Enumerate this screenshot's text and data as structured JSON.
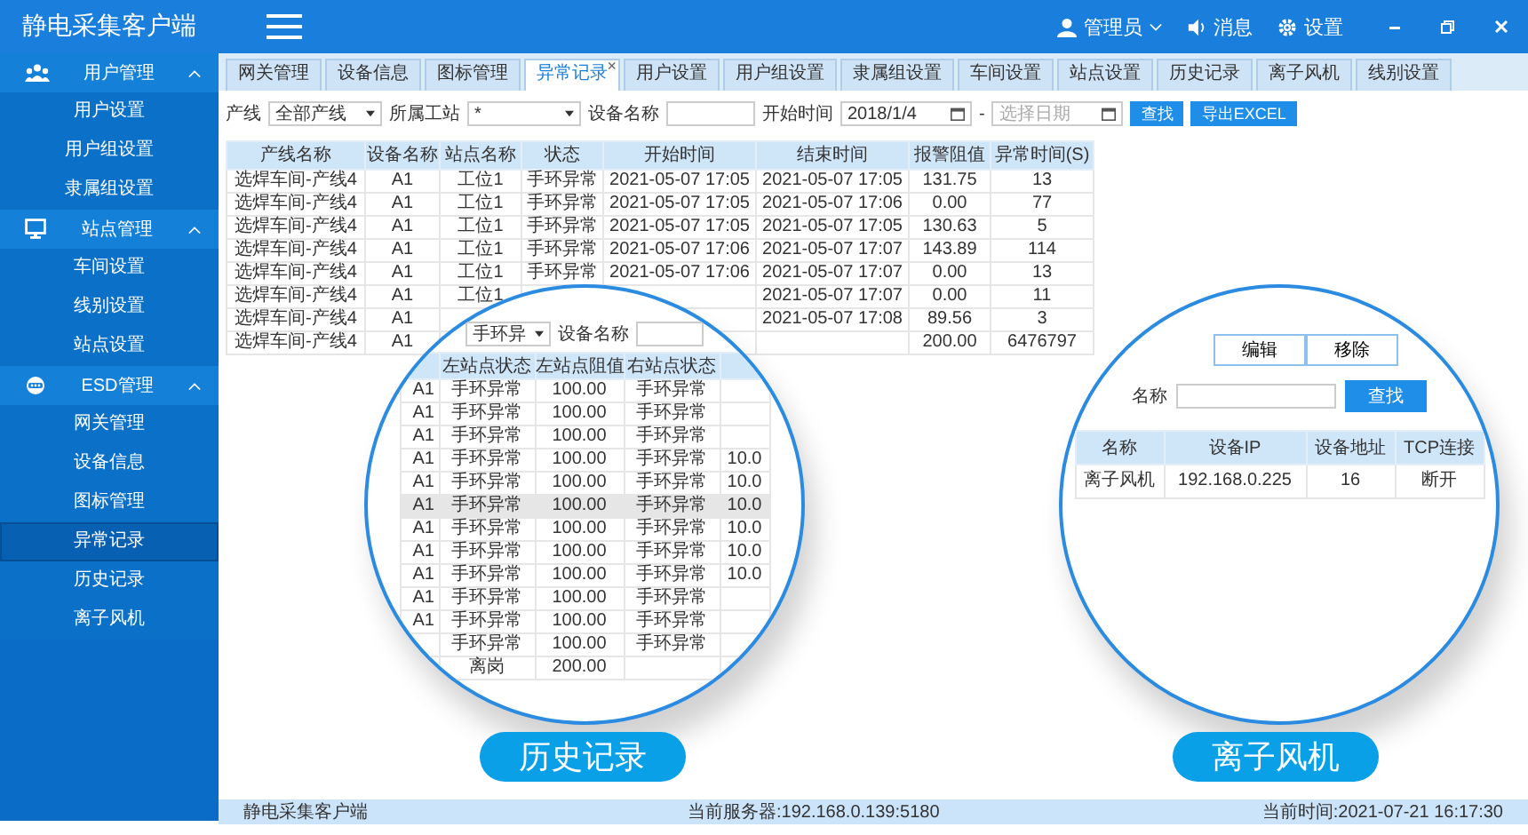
{
  "app": {
    "title": "静电采集客户端"
  },
  "topbar": {
    "user": "管理员",
    "messages": "消息",
    "settings": "设置"
  },
  "sidebar": [
    {
      "label": "用户管理",
      "expanded": true,
      "children": [
        {
          "label": "用户设置",
          "selected": false
        },
        {
          "label": "用户组设置",
          "selected": false
        },
        {
          "label": "隶属组设置",
          "selected": false
        }
      ]
    },
    {
      "label": "站点管理",
      "expanded": true,
      "children": [
        {
          "label": "车间设置",
          "selected": false
        },
        {
          "label": "线别设置",
          "selected": false
        },
        {
          "label": "站点设置",
          "selected": false
        }
      ]
    },
    {
      "label": "ESD管理",
      "expanded": true,
      "children": [
        {
          "label": "网关管理",
          "selected": false
        },
        {
          "label": "设备信息",
          "selected": false
        },
        {
          "label": "图标管理",
          "selected": false
        },
        {
          "label": "异常记录",
          "selected": true
        },
        {
          "label": "历史记录",
          "selected": false
        },
        {
          "label": "离子风机",
          "selected": false
        }
      ]
    }
  ],
  "tabs": [
    {
      "label": "网关管理",
      "selected": false
    },
    {
      "label": "设备信息",
      "selected": false
    },
    {
      "label": "图标管理",
      "selected": false
    },
    {
      "label": "异常记录",
      "selected": true
    },
    {
      "label": "用户设置",
      "selected": false
    },
    {
      "label": "用户组设置",
      "selected": false
    },
    {
      "label": "隶属组设置",
      "selected": false
    },
    {
      "label": "车间设置",
      "selected": false
    },
    {
      "label": "站点设置",
      "selected": false
    },
    {
      "label": "历史记录",
      "selected": false
    },
    {
      "label": "离子风机",
      "selected": false
    },
    {
      "label": "线别设置",
      "selected": false
    }
  ],
  "tab_close": "×",
  "filter": {
    "line_label": "产线",
    "line_value": "全部产线",
    "station_label": "所属工站",
    "station_value": "*",
    "device_label": "设备名称",
    "start_label": "开始时间",
    "start_value": "2018/1/4",
    "separator": "-",
    "end_placeholder": "选择日期",
    "search": "查找",
    "export": "导出EXCEL"
  },
  "table": {
    "columns": [
      "产线名称",
      "设备名称",
      "站点名称",
      "状态",
      "开始时间",
      "结束时间",
      "报警阻值",
      "异常时间(S)"
    ],
    "rows": [
      [
        "选焊车间-产线4",
        "A1",
        "工位1",
        "手环异常",
        "2021-05-07 17:05",
        "2021-05-07 17:05",
        "131.75",
        "13"
      ],
      [
        "选焊车间-产线4",
        "A1",
        "工位1",
        "手环异常",
        "2021-05-07 17:05",
        "2021-05-07 17:06",
        "0.00",
        "77"
      ],
      [
        "选焊车间-产线4",
        "A1",
        "工位1",
        "手环异常",
        "2021-05-07 17:05",
        "2021-05-07 17:05",
        "130.63",
        "5"
      ],
      [
        "选焊车间-产线4",
        "A1",
        "工位1",
        "手环异常",
        "2021-05-07 17:06",
        "2021-05-07 17:07",
        "143.89",
        "114"
      ],
      [
        "选焊车间-产线4",
        "A1",
        "工位1",
        "手环异常",
        "2021-05-07 17:06",
        "2021-05-07 17:07",
        "0.00",
        "13"
      ],
      [
        "选焊车间-产线4",
        "A1",
        "工位1",
        null,
        null,
        "2021-05-07 17:07",
        "0.00",
        "11"
      ],
      [
        "选焊车间-产线4",
        "A1",
        null,
        null,
        null,
        "2021-05-07 17:08",
        "89.56",
        "3"
      ],
      [
        "选焊车间-产线4",
        "A1",
        null,
        null,
        null,
        null,
        "200.00",
        "6476797"
      ]
    ]
  },
  "history_inset": {
    "label": "历史记录",
    "state_value": "手环异",
    "device_label": "设备名称",
    "columns": [
      null,
      "左站点状态",
      "左站点阻值",
      "右站点状态",
      null
    ],
    "rows": [
      {
        "cells": [
          "A1",
          "手环异常",
          "100.00",
          "手环异常",
          null
        ],
        "selected": false
      },
      {
        "cells": [
          "A1",
          "手环异常",
          "100.00",
          "手环异常",
          null
        ],
        "selected": false
      },
      {
        "cells": [
          "A1",
          "手环异常",
          "100.00",
          "手环异常",
          null
        ],
        "selected": false
      },
      {
        "cells": [
          "A1",
          "手环异常",
          "100.00",
          "手环异常",
          "10.0"
        ],
        "selected": false
      },
      {
        "cells": [
          "A1",
          "手环异常",
          "100.00",
          "手环异常",
          "10.0"
        ],
        "selected": false
      },
      {
        "cells": [
          "A1",
          "手环异常",
          "100.00",
          "手环异常",
          "10.0"
        ],
        "selected": true
      },
      {
        "cells": [
          "A1",
          "手环异常",
          "100.00",
          "手环异常",
          "10.0"
        ],
        "selected": false
      },
      {
        "cells": [
          "A1",
          "手环异常",
          "100.00",
          "手环异常",
          "10.0"
        ],
        "selected": false
      },
      {
        "cells": [
          "A1",
          "手环异常",
          "100.00",
          "手环异常",
          "10.0"
        ],
        "selected": false
      },
      {
        "cells": [
          "A1",
          "手环异常",
          "100.00",
          "手环异常",
          null
        ],
        "selected": false
      },
      {
        "cells": [
          "A1",
          "手环异常",
          "100.00",
          "手环异常",
          null
        ],
        "selected": false
      },
      {
        "cells": [
          null,
          "手环异常",
          "100.00",
          "手环异常",
          null
        ],
        "selected": false
      },
      {
        "cells": [
          null,
          "离岗",
          "200.00",
          null,
          null
        ],
        "selected": false
      }
    ]
  },
  "fan_inset": {
    "label": "离子风机",
    "buttons": [
      "编辑",
      "移除"
    ],
    "name_label": "名称",
    "search": "查找",
    "columns": [
      "名称",
      "设备IP",
      "设备地址",
      "TCP连接"
    ],
    "rows": [
      [
        "离子风机",
        "192.168.0.225",
        "16",
        "断开"
      ]
    ]
  },
  "status_bar": {
    "app": "静电采集客户端",
    "server": "当前服务器:192.168.0.139:5180",
    "time": "当前时间:2021-07-21 16:17:30"
  }
}
